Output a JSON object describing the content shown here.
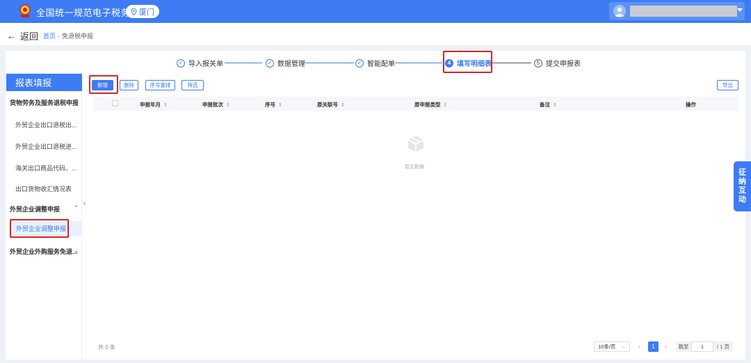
{
  "header": {
    "title": "全国统一规范电子税务局",
    "city": "厦门"
  },
  "nav": {
    "back_label": "返回",
    "breadcrumb": [
      {
        "label": "首页"
      },
      {
        "label": "免退税申报"
      }
    ]
  },
  "steps": [
    {
      "label": "导入报关单",
      "state": "done"
    },
    {
      "label": "数据管理",
      "state": "done"
    },
    {
      "label": "智能配单",
      "state": "done"
    },
    {
      "label": "填写明细表",
      "state": "active",
      "num": "4"
    },
    {
      "label": "提交申报表",
      "state": "pending",
      "num": "5"
    }
  ],
  "sidebar": {
    "title": "报表填报",
    "groups": [
      {
        "label": "货物劳务及服务退税申报",
        "expanded": true,
        "items": [
          {
            "label": "外贸企业出口退税出..."
          },
          {
            "label": "外贸企业出口退税进..."
          },
          {
            "label": "海关出口商品代码、..."
          },
          {
            "label": "出口货物收汇情况表"
          }
        ]
      },
      {
        "label": "外贸企业调整申报",
        "expanded": true,
        "items": [
          {
            "label": "外贸企业调整申报",
            "active": true
          }
        ]
      },
      {
        "label": "外贸企业外购服务免退...",
        "expanded": false,
        "items": []
      }
    ]
  },
  "toolbar": {
    "add": "新增",
    "delete": "删除",
    "reorder": "序号重排",
    "filter": "筛选",
    "export": "导出"
  },
  "table": {
    "columns": [
      "申报年月",
      "申报批次",
      "序号",
      "原关联号",
      "原申报类型",
      "备注",
      "操作"
    ],
    "empty_text": "暂无数据"
  },
  "pagination": {
    "total_text": "共 0 条",
    "page_size": "10条/页",
    "current_page": "1",
    "jump_label": "跳至",
    "jump_value": "1",
    "total_pages": "/ 1 页"
  },
  "float_tab": {
    "chars": [
      "征",
      "纳",
      "互",
      "动"
    ]
  },
  "colors": {
    "primary": "#3d7cf4",
    "highlight_box": "#e02020"
  }
}
